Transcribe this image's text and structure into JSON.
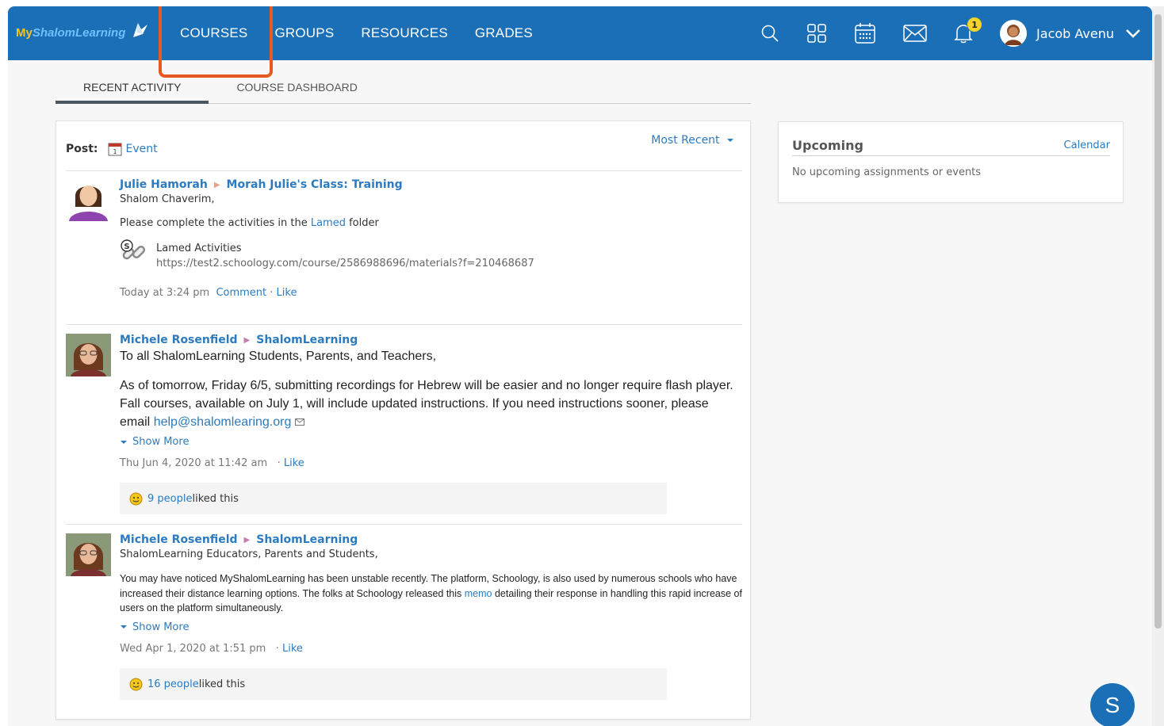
{
  "logo": {
    "my": "My",
    "rest": "ShalomLearning"
  },
  "nav": [
    "COURSES",
    "GROUPS",
    "RESOURCES",
    "GRADES"
  ],
  "header": {
    "notification_count": "1",
    "user_name": "Jacob Avenu"
  },
  "tabs": [
    "RECENT ACTIVITY",
    "COURSE DASHBOARD"
  ],
  "feed": {
    "post_label": "Post:",
    "post_event": "Event",
    "sort_label": "Most Recent",
    "posts": [
      {
        "author": "Julie Hamorah",
        "target": "Morah Julie's Class: Training",
        "greeting": "Shalom Chaverim,",
        "line_pre": "Please complete the activities in the ",
        "line_link": "Lamed",
        "line_post": " folder",
        "attachment_title": "Lamed Activities",
        "attachment_url": "https://test2.schoology.com/course/2586988696/materials?f=210468687",
        "time": "Today at 3:24 pm",
        "comment": "Comment",
        "like": "Like"
      },
      {
        "author": "Michele Rosenfield",
        "target": "ShalomLearning",
        "greeting": "To all ShalomLearning Students, Parents, and Teachers,",
        "para1": "As of tomorrow, Friday 6/5, submitting recordings for Hebrew will be easier and no longer require flash player.  Fall courses, available on July 1, will include updated instructions. If you need instructions sooner, please email ",
        "email": "help@shalomlearing.org",
        "show_more": "Show More",
        "time": "Thu Jun 4, 2020 at 11:42 am",
        "like": "Like",
        "likes_count": "9 people",
        "likes_suffix": " liked this"
      },
      {
        "author": "Michele Rosenfield",
        "target": "ShalomLearning",
        "greeting": "ShalomLearning Educators, Parents and Students,",
        "para_pre": "You may have noticed MyShalomLearning has been unstable recently. The platform, Schoology, is also used by numerous schools who have increased their distance learning options. The folks at Schoology released this ",
        "para_link": "memo",
        "para_post": " detailing their response in handling this rapid increase of users on the platform simultaneously.",
        "show_more": "Show More",
        "time": "Wed Apr 1, 2020 at 1:51 pm",
        "like": "Like",
        "likes_count": "16 people",
        "likes_suffix": " liked this"
      }
    ]
  },
  "upcoming": {
    "title": "Upcoming",
    "calendar_link": "Calendar",
    "empty_text": "No upcoming assignments or events"
  },
  "chat_button": "S",
  "colors": {
    "brand": "#1a6fb6",
    "link": "#2d7bbf",
    "highlight": "#e8591f",
    "badge": "#f5d32a"
  }
}
